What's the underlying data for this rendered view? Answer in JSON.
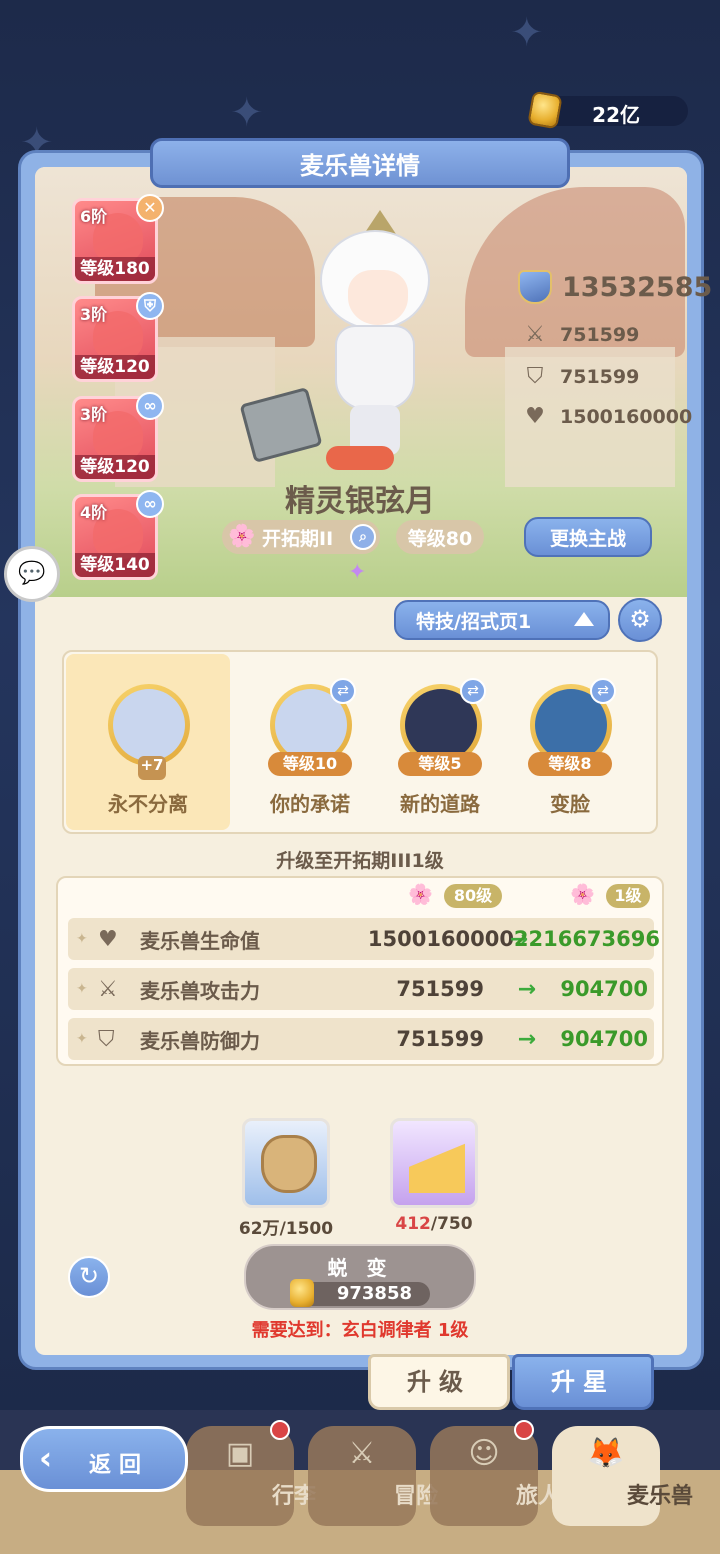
{
  "currency": {
    "value": "22亿"
  },
  "panel": {
    "title": "麦乐兽详情"
  },
  "beasts": [
    {
      "tier": "6阶",
      "level": "等级180",
      "badge": "✕"
    },
    {
      "tier": "3阶",
      "level": "等级120",
      "badge": "⛨"
    },
    {
      "tier": "3阶",
      "level": "等级120",
      "badge": "∞"
    },
    {
      "tier": "4阶",
      "level": "等级140",
      "badge": "∞"
    }
  ],
  "character": {
    "name": "精灵银弦月",
    "stage": "开拓期II",
    "level": "等级80",
    "swap_label": "更换主战"
  },
  "stats": {
    "power": "13532585",
    "attack": "751599",
    "defense": "751599",
    "hp": "1500160000"
  },
  "skills": {
    "page_label": "特技/招式页1",
    "items": [
      {
        "name": "永不分离",
        "level": "",
        "plus": "+7"
      },
      {
        "name": "你的承诺",
        "level": "等级10"
      },
      {
        "name": "新的道路",
        "level": "等级5"
      },
      {
        "name": "变脸",
        "level": "等级8"
      }
    ]
  },
  "upgrade": {
    "title": "升级至开拓期III1级",
    "from_badge": "80级",
    "to_badge": "1级",
    "rows": [
      {
        "label": "麦乐兽生命值",
        "old": "1500160000",
        "new": "2216673696",
        "icon": "heart-icon"
      },
      {
        "label": "麦乐兽攻击力",
        "old": "751599",
        "new": "904700",
        "icon": "swords-icon"
      },
      {
        "label": "麦乐兽防御力",
        "old": "751599",
        "new": "904700",
        "icon": "shield-icon"
      }
    ]
  },
  "materials": [
    {
      "have": "62万",
      "need": "/1500"
    },
    {
      "have": "412",
      "need": "/750"
    }
  ],
  "evolve": {
    "label": "蜕 变",
    "cost": "973858",
    "requirement": "需要达到：玄白调律者 1级"
  },
  "tabs": {
    "upgrade": "升级",
    "star": "升星"
  },
  "nav": {
    "back": "返回",
    "items": [
      "行李",
      "冒险",
      "旅人",
      "麦乐兽"
    ]
  }
}
